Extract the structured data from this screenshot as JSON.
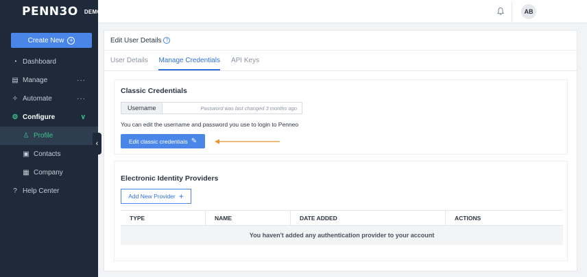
{
  "logo": {
    "brand": "PENN3O",
    "badge": "DEMO"
  },
  "sidebar": {
    "create_label": "Create New",
    "items": [
      {
        "label": "Dashboard",
        "icon": "dashboard-icon"
      },
      {
        "label": "Manage",
        "icon": "briefcase-icon",
        "more": "···"
      },
      {
        "label": "Automate",
        "icon": "magic-wand-icon",
        "more": "···"
      },
      {
        "label": "Configure",
        "icon": "gear-icon"
      },
      {
        "label": "Profile",
        "icon": "user-icon"
      },
      {
        "label": "Contacts",
        "icon": "contact-card-icon"
      },
      {
        "label": "Company",
        "icon": "building-icon"
      },
      {
        "label": "Help Center",
        "icon": "help-circle-icon"
      }
    ]
  },
  "topbar": {
    "avatar_initials": "AB"
  },
  "card": {
    "title": "Edit User Details",
    "tabs": [
      "User Details",
      "Manage Credentials",
      "API Keys"
    ],
    "active_tab": "Manage Credentials"
  },
  "classic": {
    "title": "Classic Credentials",
    "username_label": "Username",
    "password_note": "Password was last changed 3 months ago",
    "info": "You can edit the username and password you use to login to Penneo",
    "edit_button": "Edit classic credentials"
  },
  "eid": {
    "title": "Electronic Identity Providers",
    "add_button": "Add New Provider",
    "columns": [
      "TYPE",
      "NAME",
      "DATE ADDED",
      "ACTIONS"
    ],
    "empty_message": "You haven't added any authentication provider to your account"
  },
  "colors": {
    "accent": "#4a86e8",
    "sidebar": "#1e2a3a",
    "active_green": "#3cc28a",
    "arrow": "#e8952c"
  }
}
